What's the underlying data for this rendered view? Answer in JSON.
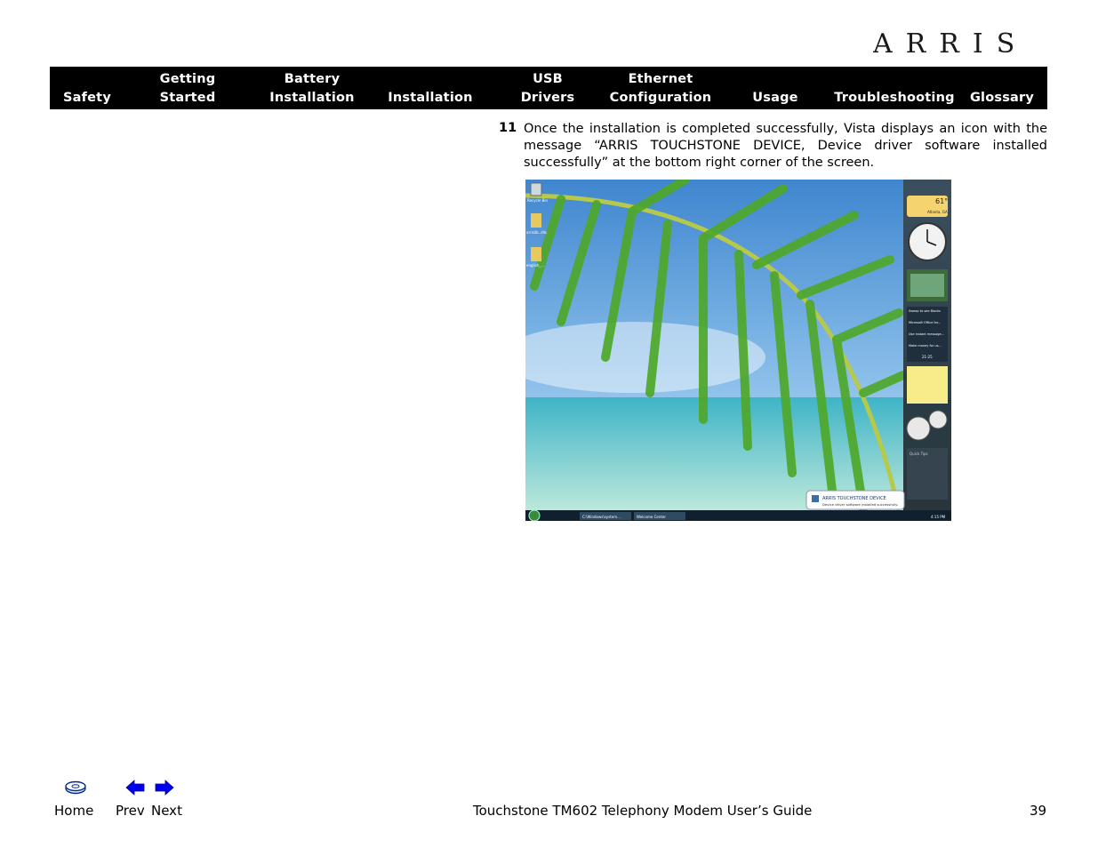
{
  "brand": {
    "logo_text": "ARRIS"
  },
  "nav": {
    "items": [
      {
        "line1": "",
        "line2": "Safety"
      },
      {
        "line1": "Getting",
        "line2": "Started"
      },
      {
        "line1": "Battery",
        "line2": "Installation"
      },
      {
        "line1": "",
        "line2": "Installation"
      },
      {
        "line1": "USB",
        "line2": "Drivers"
      },
      {
        "line1": "Ethernet",
        "line2": "Configuration"
      },
      {
        "line1": "",
        "line2": "Usage"
      },
      {
        "line1": "",
        "line2": "Troubleshooting"
      },
      {
        "line1": "",
        "line2": "Glossary"
      }
    ]
  },
  "step": {
    "number": "11",
    "text": "Once the installation is completed successfully, Vista displays an icon with the message “ARRIS TOUCHSTONE DEVICE, Device driver software installed successfully” at the bottom right corner of the screen."
  },
  "screenshot": {
    "desktop_icons": [
      "Recycle Bin",
      "arrislib..dlls",
      "english_..."
    ],
    "weather_temp": "61°",
    "weather_city": "Atlanta, GA",
    "feed_items": [
      "Sweep to see Blocks",
      "Microsoft Office for...",
      "Use instant message...",
      "Make money for us..."
    ],
    "feed_pager": "21-25",
    "notes_label": "Quick Tips",
    "balloon_title": "ARRIS TOUCHSTONE DEVICE",
    "balloon_text": "Device driver software installed successfully.",
    "taskbar_items": [
      "C:\\Windows\\system...",
      "Welcome Center"
    ],
    "clock": "4:15 PM"
  },
  "footer": {
    "home_label": "Home",
    "prev_label": "Prev",
    "next_label": "Next",
    "title": "Touchstone TM602 Telephony Modem User’s Guide",
    "page_number": "39"
  },
  "colors": {
    "navbar_bg": "#000000",
    "nav_text": "#ffffff",
    "arrow_blue": "#0000ee",
    "sky": "#4a8fd0",
    "sea": "#7fd3cf",
    "palm": "#5cb82a"
  }
}
